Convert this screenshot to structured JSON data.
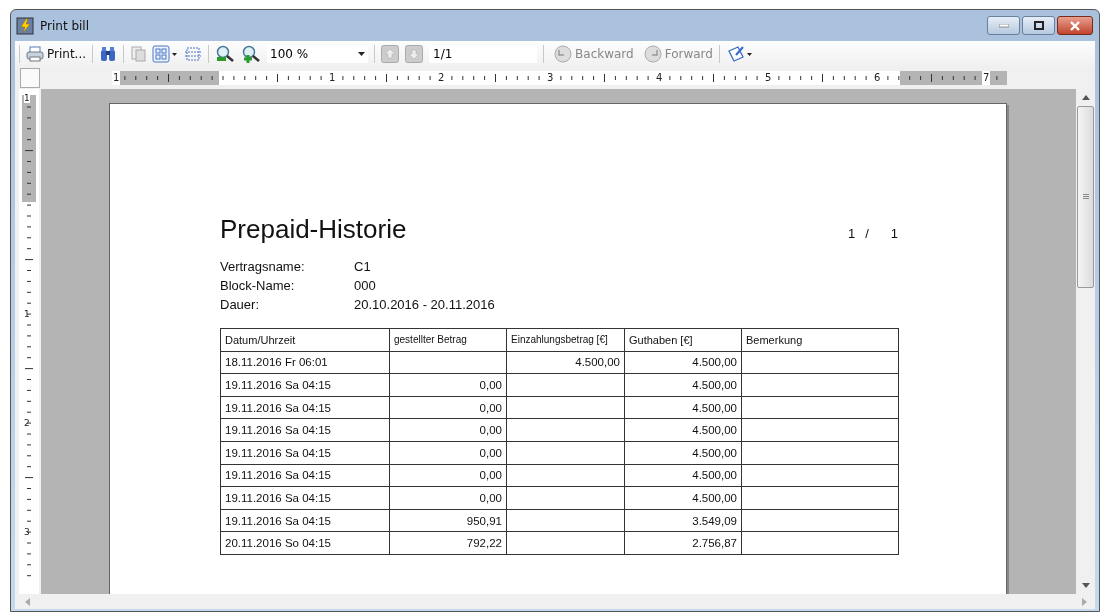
{
  "window": {
    "title": "Print bill"
  },
  "toolbar": {
    "print": "Print...",
    "zoom": "100 %",
    "page": "1/1",
    "backward": {
      "label": "Backward",
      "disabled": true
    },
    "forward": {
      "label": "Forward",
      "disabled": true
    }
  },
  "ruler_h": [
    "1",
    "1",
    "2",
    "3",
    "4",
    "5",
    "6",
    "7"
  ],
  "ruler_v": [
    "1",
    "1",
    "2",
    "3"
  ],
  "document": {
    "title": "Prepaid-Historie",
    "page_no": "1",
    "page_sep": "/",
    "page_total": "1",
    "info": [
      {
        "label": "Vertragsname:",
        "value": "C1"
      },
      {
        "label": "Block-Name:",
        "value": "000"
      },
      {
        "label": "Dauer:",
        "value": "20.10.2016 - 20.11.2016"
      }
    ],
    "table": {
      "columns": [
        "Datum/Uhrzeit",
        "gestellter Betrag",
        "Einzahlungsbetrag [€]",
        "Guthaben [€]",
        "Bemerkung"
      ],
      "rows": [
        [
          "18.11.2016 Fr 06:01",
          "",
          "4.500,00",
          "4.500,00",
          ""
        ],
        [
          "19.11.2016 Sa 04:15",
          "0,00",
          "",
          "4.500,00",
          ""
        ],
        [
          "19.11.2016 Sa 04:15",
          "0,00",
          "",
          "4.500,00",
          ""
        ],
        [
          "19.11.2016 Sa 04:15",
          "0,00",
          "",
          "4.500,00",
          ""
        ],
        [
          "19.11.2016 Sa 04:15",
          "0,00",
          "",
          "4.500,00",
          ""
        ],
        [
          "19.11.2016 Sa 04:15",
          "0,00",
          "",
          "4.500,00",
          ""
        ],
        [
          "19.11.2016 Sa 04:15",
          "0,00",
          "",
          "4.500,00",
          ""
        ],
        [
          "19.11.2016 Sa 04:15",
          "950,91",
          "",
          "3.549,09",
          ""
        ],
        [
          "20.11.2016 So 04:15",
          "792,22",
          "",
          "2.756,87",
          ""
        ]
      ]
    }
  }
}
